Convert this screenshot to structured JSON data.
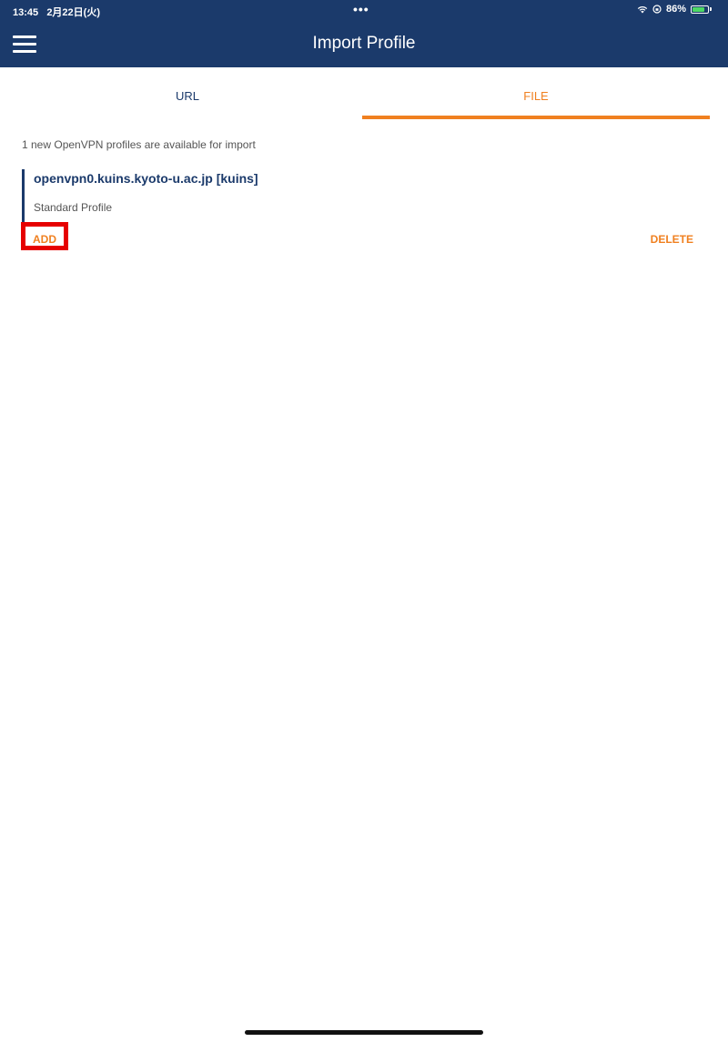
{
  "status_bar": {
    "time": "13:45",
    "date": "2月22日(火)",
    "dots": "•••",
    "wifi_icon": "wifi-icon",
    "orientation_lock_icon": "orientation-lock-icon",
    "battery_percent": "86%",
    "battery_level": 0.86,
    "battery_color": "#4cd964"
  },
  "header": {
    "title": "Import Profile",
    "menu_icon": "hamburger-menu-icon",
    "background_color": "#1b3a6b"
  },
  "tabs": [
    {
      "label": "URL",
      "selected": false
    },
    {
      "label": "FILE",
      "selected": true
    }
  ],
  "main": {
    "info_text": "1 new OpenVPN profiles are available for import",
    "profile": {
      "name": "openvpn0.kuins.kyoto-u.ac.jp [kuins]",
      "type": "Standard Profile",
      "add_label": "ADD",
      "delete_label": "DELETE"
    }
  },
  "colors": {
    "accent": "#f08020",
    "primary": "#1b3a6b",
    "highlight": "#e60000"
  }
}
